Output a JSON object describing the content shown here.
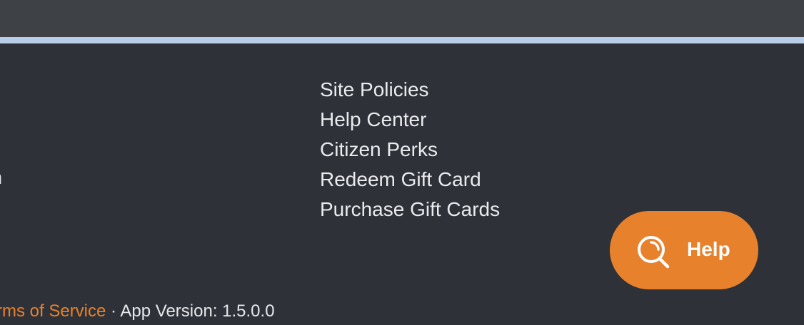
{
  "footer": {
    "links": [
      "Site Policies",
      "Help Center",
      "Citizen Perks",
      "Redeem Gift Card",
      "Purchase Gift Cards"
    ],
    "left_column_fragments": [
      ".",
      "n"
    ],
    "bottom": {
      "terms_link": "rms of Service",
      "separator": " · ",
      "app_version": "App Version: 1.5.0.0"
    }
  },
  "help_button": {
    "label": "Help",
    "icon": "search-icon"
  },
  "colors": {
    "top_bar": "#3e4247",
    "accent_line": "#b8cde8",
    "footer_bg": "#2e3138",
    "link_text": "#e9ebee",
    "accent_orange": "#e8812b"
  }
}
